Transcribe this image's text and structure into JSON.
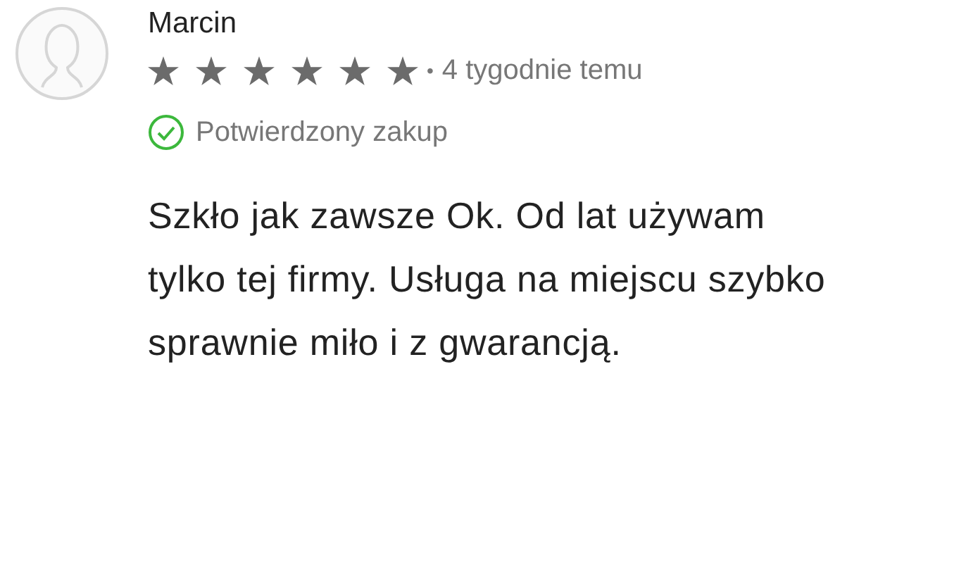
{
  "review": {
    "author": "Marcin",
    "stars": 6,
    "separator": "•",
    "time": "4 tygodnie temu",
    "verified": true,
    "verified_label": "Potwierdzony zakup",
    "text": "Szkło jak zawsze Ok. Od lat używam tylko tej firmy. Usługa na miejscu szybko sprawnie miło i z gwarancją."
  }
}
